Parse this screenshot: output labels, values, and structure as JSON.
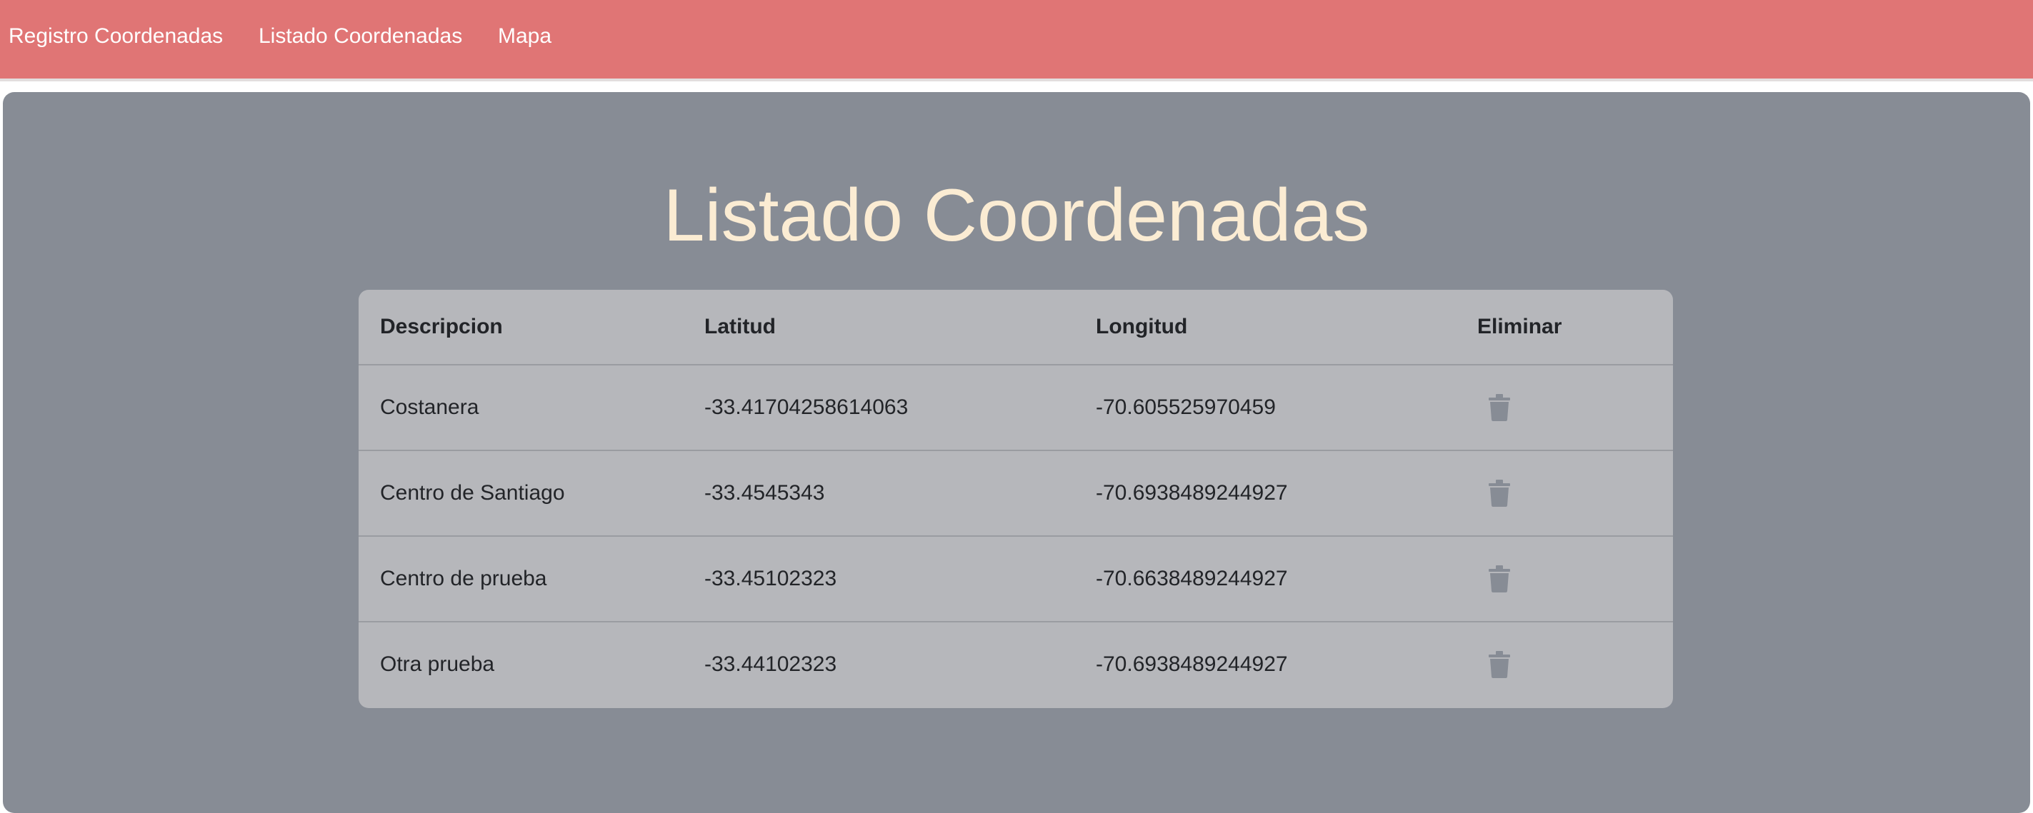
{
  "nav": {
    "items": [
      {
        "label": "Registro Coordenadas"
      },
      {
        "label": "Listado Coordenadas"
      },
      {
        "label": "Mapa"
      }
    ]
  },
  "colors": {
    "navbar": "#e07575",
    "panel": "#878c95",
    "title": "#fbecd3",
    "table_bg": "#b6b7bb",
    "trash_icon": "#878c95"
  },
  "page": {
    "title": "Listado Coordenadas"
  },
  "table": {
    "headers": {
      "descripcion": "Descripcion",
      "latitud": "Latitud",
      "longitud": "Longitud",
      "eliminar": "Eliminar"
    },
    "delete_icon": "trash-icon",
    "rows": [
      {
        "descripcion": "Costanera",
        "latitud": "-33.41704258614063",
        "longitud": "-70.605525970459"
      },
      {
        "descripcion": "Centro de Santiago",
        "latitud": "-33.4545343",
        "longitud": "-70.6938489244927"
      },
      {
        "descripcion": "Centro de prueba",
        "latitud": "-33.45102323",
        "longitud": "-70.6638489244927"
      },
      {
        "descripcion": "Otra prueba",
        "latitud": "-33.44102323",
        "longitud": "-70.6938489244927"
      }
    ]
  }
}
